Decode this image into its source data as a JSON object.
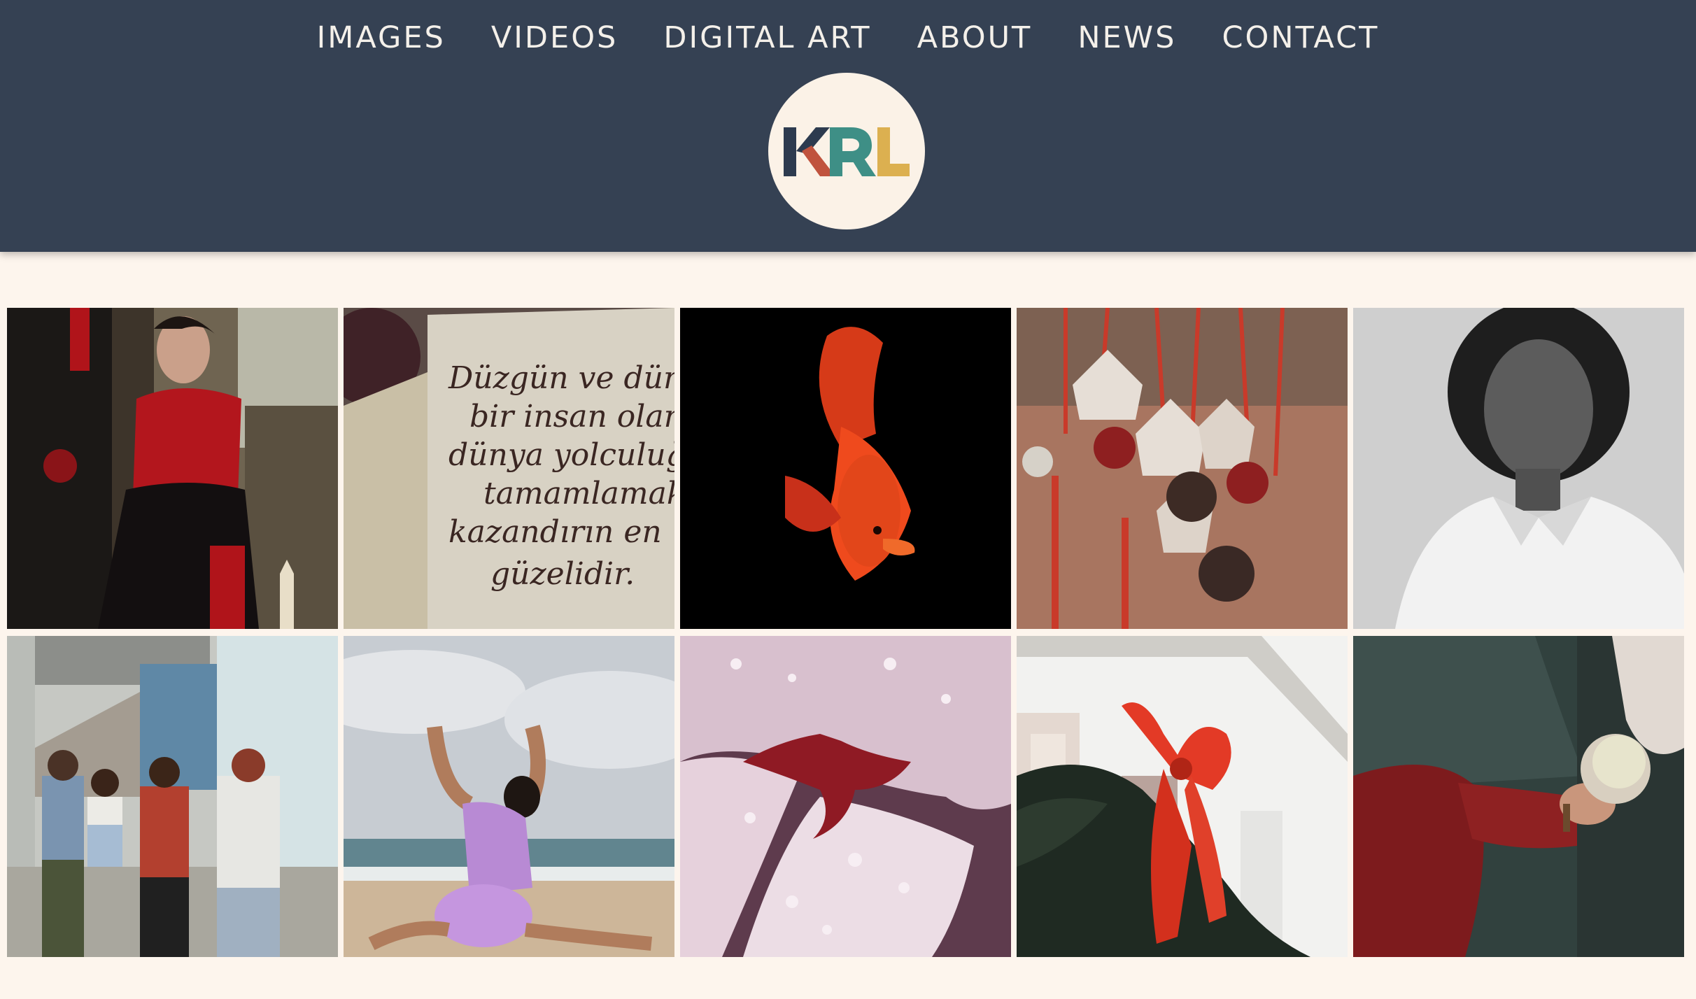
{
  "nav": {
    "items": [
      {
        "id": "images",
        "label": "IMAGES"
      },
      {
        "id": "videos",
        "label": "VIDEOS"
      },
      {
        "id": "digital-art",
        "label": "DIGITAL ART"
      },
      {
        "id": "about",
        "label": "ABOUT"
      },
      {
        "id": "news",
        "label": "NEWS"
      },
      {
        "id": "contact",
        "label": "CONTACT"
      }
    ]
  },
  "logo": {
    "letters": [
      "K",
      "R",
      "L"
    ],
    "colors": [
      "#2d3b4f",
      "#c0533e",
      "#3e8f86",
      "#dcb050"
    ]
  },
  "theme": {
    "header_bg": "#354153",
    "page_bg": "#fdf5ed",
    "nav_text": "#f4f0ea"
  },
  "gallery": {
    "tiles": [
      {
        "subject": "woman-red-dress"
      },
      {
        "subject": "calligraphy-note",
        "text_lines": [
          "Düzgün ve dürüst",
          "bir insan olarak",
          "dünya yolculuğunu",
          "tamamlamak",
          "kazandırın en",
          "güzelidir."
        ]
      },
      {
        "subject": "red-betta-fish"
      },
      {
        "subject": "christmas-birdhouse-ornaments"
      },
      {
        "subject": "bw-woman-portrait"
      },
      {
        "subject": "group-streetwear"
      },
      {
        "subject": "beach-dancer"
      },
      {
        "subject": "flower-dewdrops"
      },
      {
        "subject": "christmas-bow-garland"
      },
      {
        "subject": "red-sleeve-cup"
      }
    ]
  }
}
